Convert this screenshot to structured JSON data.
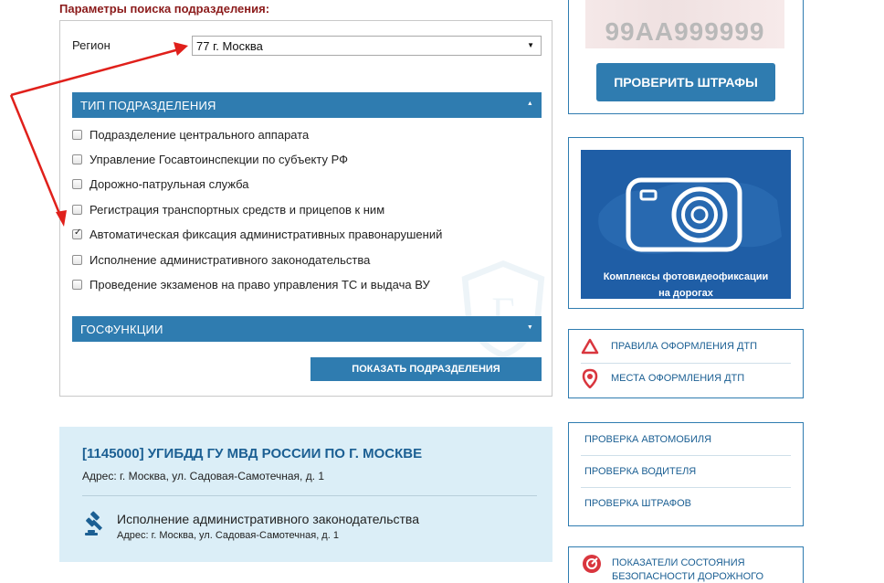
{
  "search": {
    "heading": "Параметры поиска подразделения:",
    "region_label": "Регион",
    "region_value": "77 г. Москва",
    "type_section": "Тип подразделения",
    "types": [
      {
        "label": "Подразделение центрального аппарата",
        "checked": false
      },
      {
        "label": "Управление Госавтоинспекции по субъекту РФ",
        "checked": false
      },
      {
        "label": "Дорожно-патрульная служба",
        "checked": false
      },
      {
        "label": "Регистрация транспортных средств и прицепов к ним",
        "checked": false
      },
      {
        "label": "Автоматическая фиксация административных правонарушений",
        "checked": true
      },
      {
        "label": "Исполнение административного законодательства",
        "checked": false
      },
      {
        "label": "Проведение экзаменов на право управления ТС и выдача ВУ",
        "checked": false
      }
    ],
    "gos_section": "Госфункции",
    "show_button": "Показать подразделения"
  },
  "result": {
    "title": "[1145000] УГИБДД ГУ МВД РОССИИ ПО Г. МОСКВЕ",
    "address": "Адрес: г. Москва, ул. Садовая-Самотечная, д. 1",
    "function": "Исполнение административного законодательства",
    "function_address": "Адрес: г. Москва, ул. Садовая-Самотечная, д. 1"
  },
  "sidebar": {
    "plate_text": "99АА999999",
    "check_fines_button": "Проверить штрафы",
    "camera_caption_1": "Комплексы фотовидеофиксации",
    "camera_caption_2": "на дорогах",
    "dtp_rules": "Правила оформления ДТП",
    "dtp_places": "Места оформления ДТП",
    "check_car": "Проверка автомобиля",
    "check_driver": "Проверка водителя",
    "check_fines": "Проверка штрафов",
    "stats_line1": "Показатели состояния",
    "stats_line2": "безопасности дорожного"
  },
  "colors": {
    "accent": "#2f7cb0",
    "heading_red": "#8b1a1a",
    "arrow_red": "#e0201b",
    "result_bg": "#dbeef7"
  }
}
